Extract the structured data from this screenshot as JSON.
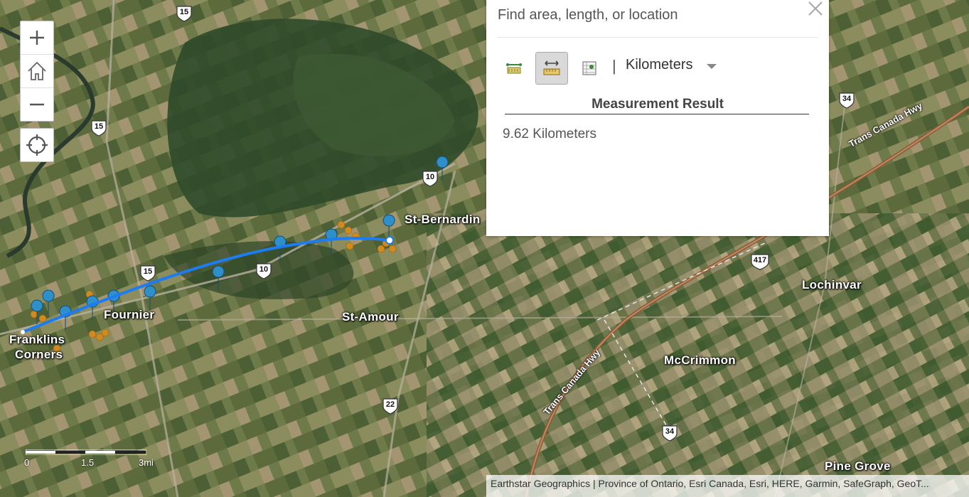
{
  "map": {
    "places": {
      "st_bernardin": "St-Bernardin",
      "fournier": "Fournier",
      "franklins_line1": "Franklins",
      "franklins_line2": "Corners",
      "st_amour": "St-Amour",
      "lochinvar": "Lochinvar",
      "mccrimmon": "McCrimmon",
      "pine_grove": "Pine Grove"
    },
    "roads": {
      "trans_canada_1": "Trans Canada Hwy",
      "trans_canada_2": "Trans Canada Hwy"
    },
    "shields": {
      "s15a": "15",
      "s15b": "15",
      "s15c": "15",
      "s10a": "10",
      "s10b": "10",
      "s34a": "34",
      "s34b": "34",
      "s417": "417",
      "s22": "22"
    },
    "scalebar": {
      "t0": "0",
      "t1": "1.5",
      "t2": "3mi"
    },
    "attribution": "Earthstar Geographics | Province of Ontario, Esri Canada, Esri, HERE, Garmin, SafeGraph, GeoT..."
  },
  "controls": {
    "zoom_in_icon": "plus-icon",
    "home_icon": "home-icon",
    "zoom_out_icon": "minus-icon",
    "locate_icon": "locate-icon"
  },
  "measure_panel": {
    "header": "Find area, length, or location",
    "unit": "Kilometers",
    "result_title": "Measurement Result",
    "result_value": "9.62 Kilometers",
    "active_tool": "distance"
  },
  "colors": {
    "measure_line": "#1c7cf0",
    "marker_blue": "#2e8fc9",
    "marker_orange": "#d08a1e"
  }
}
